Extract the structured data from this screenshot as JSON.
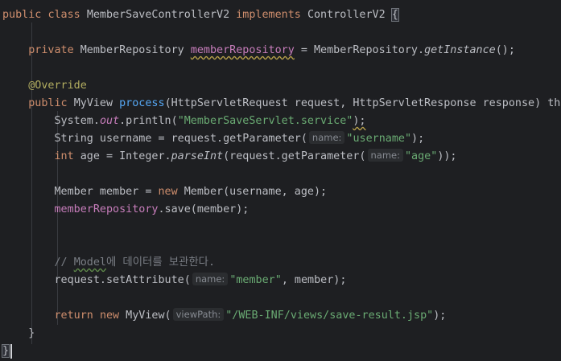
{
  "editor": {
    "colors": {
      "background": "#1e1f22",
      "keyword": "#cf8e6d",
      "string": "#6aab73",
      "field": "#c77dbb",
      "method": "#56a8f5",
      "annotation": "#b3ae60",
      "comment": "#7a7e85",
      "text": "#bcbec4"
    },
    "line1": {
      "kw_public": "public",
      "kw_class": "class",
      "class_name": "MemberSaveControllerV2",
      "kw_implements": "implements",
      "iface": "ControllerV2",
      "brace": "{"
    },
    "line3": {
      "kw_private": "private",
      "type": "MemberRepository",
      "field": "memberRepository",
      "eq": "=",
      "rhs_type": "MemberRepository.",
      "rhs_method": "getInstance",
      "rhs_end": "();"
    },
    "line5": {
      "annotation": "@Override"
    },
    "line6": {
      "kw_public": "public",
      "ret": "MyView",
      "method": "process",
      "params": "(HttpServletRequest request, HttpServletResponse response) thr"
    },
    "line7": {
      "a": "System.",
      "b": "out",
      "c": ".println(",
      "str": "\"MemberSaveServlet.service\"",
      "d": ");"
    },
    "line8": {
      "a": "String username = request.getParameter(",
      "hint": "name:",
      "str": "\"username\"",
      "d": ");"
    },
    "line9": {
      "kw": "int",
      "a": " age = Integer.",
      "m": "parseInt",
      "b": "(request.getParameter(",
      "hint": "name:",
      "str": "\"age\"",
      "d": "));"
    },
    "line11": {
      "a": "Member member = ",
      "kw": "new",
      "b": " Member(username, age);"
    },
    "line12": {
      "field": "memberRepository",
      "b": ".save(member);"
    },
    "line15": {
      "a": "// ",
      "model": "Model",
      "b": "에 데이터를 보관한다."
    },
    "line16": {
      "a": "request.setAttribute(",
      "hint": "name:",
      "str": "\"member\"",
      "b": ", member);"
    },
    "line18": {
      "kw_return": "return",
      "kw_new": "new",
      "a": " MyView(",
      "hint": "viewPath:",
      "str": "\"/WEB-INF/views/save-result.jsp\"",
      "b": ");"
    },
    "line19": {
      "brace": "}"
    },
    "line20": {
      "brace": "}"
    }
  }
}
